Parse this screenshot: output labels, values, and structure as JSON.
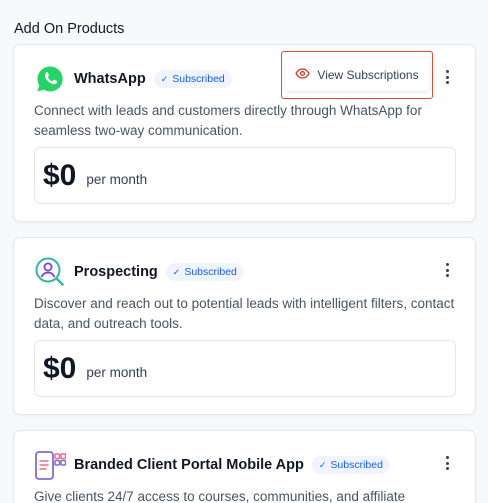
{
  "section": {
    "title": "Add On Products"
  },
  "products": [
    {
      "name": "WhatsApp",
      "badge": "Subscribed",
      "description": "Connect with leads and customers directly through WhatsApp for seamless two-way communication.",
      "price": "$0",
      "period": "per month",
      "icon": "whatsapp-icon",
      "action": {
        "label": "View Subscriptions",
        "icon": "eye-icon"
      }
    },
    {
      "name": "Prospecting",
      "badge": "Subscribed",
      "description": "Discover and reach out to potential leads with intelligent filters, contact data, and outreach tools.",
      "price": "$0",
      "period": "per month",
      "icon": "prospecting-icon"
    },
    {
      "name": "Branded Client Portal Mobile App",
      "badge": "Subscribed",
      "description": "Give clients 24/7 access to courses, communities, and affiliate",
      "icon": "mobile-app-icon"
    }
  ],
  "colors": {
    "badge_text": "#155eef",
    "badge_bg": "#eff4ff",
    "whatsapp_green": "#25d366",
    "highlight_border": "#e04a2f"
  }
}
